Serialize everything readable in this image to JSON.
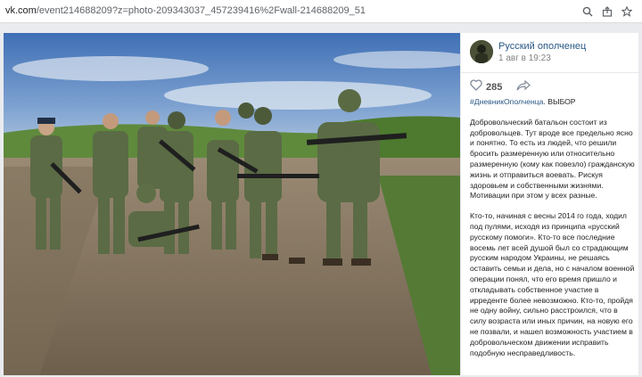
{
  "browser": {
    "url_domain": "vk.com",
    "url_path": "/event214688209?z=photo-209343037_457239416%2Fwall-214688209_51",
    "icons": [
      "search-icon",
      "share-page-icon",
      "star-icon"
    ]
  },
  "post": {
    "author": "Русский ополченец",
    "date": "1 авг в 19:23",
    "likes": "285",
    "hashtag": "#ДневникОполченца",
    "hashtag_suffix": ". ВЫБОР",
    "paragraph1": "Добровольческий батальон состоит из добровольцев. Тут вроде все предельно ясно и понятно. То есть из людей, что решили бросить размеренную или относительно размеренную (кому как повезло) гражданскую жизнь и отправиться воевать. Рискуя здоровьем и собственными жизнями. Мотивации при этом у всех разные.",
    "paragraph2": "Кто-то, начиная с весны 2014 го года, ходил под пулями, исходя из принципа «русский русскому помоги». Кто-то все последние восемь лет всей душой был со страдающим русским народом Украины, не решаясь оставить семьи и дела, но с началом военной операции понял, что его время пришло и откладывать собственное участие в ирредентe более невозможно. Кто-то, пройдя не одну войну, сильно расстроился, что в силу возраста или иных причин, на новую его не позвали, и нашел возможность участием в добровольческом движении исправить подобную несправедливость."
  },
  "colors": {
    "link": "#2a5885",
    "viewer_bg": "#e9ebee"
  }
}
